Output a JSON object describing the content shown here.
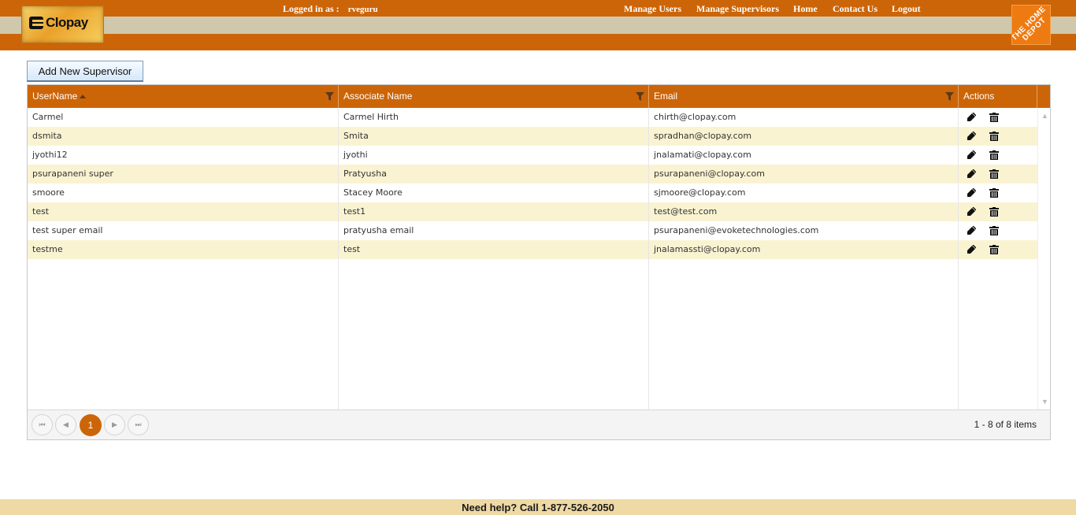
{
  "header": {
    "logo_left": "Clopay",
    "logged_in_label": "Logged in as :",
    "logged_in_user": "rveguru",
    "nav": [
      {
        "label": "Manage Users"
      },
      {
        "label": "Manage Supervisors"
      },
      {
        "label": "Home"
      },
      {
        "label": "Contact Us"
      },
      {
        "label": "Logout"
      }
    ],
    "logo_right": "THE HOME DEPOT",
    "colors": {
      "bar": "#cc6508",
      "band": "#d0c8ac"
    }
  },
  "toolbar": {
    "add_label": "Add New Supervisor"
  },
  "grid": {
    "columns": [
      {
        "label": "UserName",
        "sorted": "asc",
        "filter": true
      },
      {
        "label": "Associate Name",
        "filter": true
      },
      {
        "label": "Email",
        "filter": true
      },
      {
        "label": "Actions",
        "filter": false
      }
    ],
    "rows": [
      {
        "username": "Carmel",
        "associate": "Carmel Hirth",
        "email": "chirth@clopay.com"
      },
      {
        "username": "dsmita",
        "associate": "Smita",
        "email": "spradhan@clopay.com"
      },
      {
        "username": "jyothi12",
        "associate": "jyothi",
        "email": "jnalamati@clopay.com"
      },
      {
        "username": "psurapaneni super",
        "associate": "Pratyusha",
        "email": "psurapaneni@clopay.com"
      },
      {
        "username": "smoore",
        "associate": "Stacey Moore",
        "email": "sjmoore@clopay.com"
      },
      {
        "username": "test",
        "associate": "test1",
        "email": "test@test.com"
      },
      {
        "username": "test super email",
        "associate": "pratyusha email",
        "email": "psurapaneni@evoketechnologies.com"
      },
      {
        "username": "testme",
        "associate": "test",
        "email": "jnalamassti@clopay.com"
      }
    ],
    "action_icons": [
      "edit-icon",
      "delete-icon"
    ],
    "row_alt_color": "#faf3d2"
  },
  "pager": {
    "current_page": "1",
    "info": "1 - 8 of 8 items"
  },
  "footer": {
    "help_text": "Need help? Call 1-877-526-2050"
  }
}
